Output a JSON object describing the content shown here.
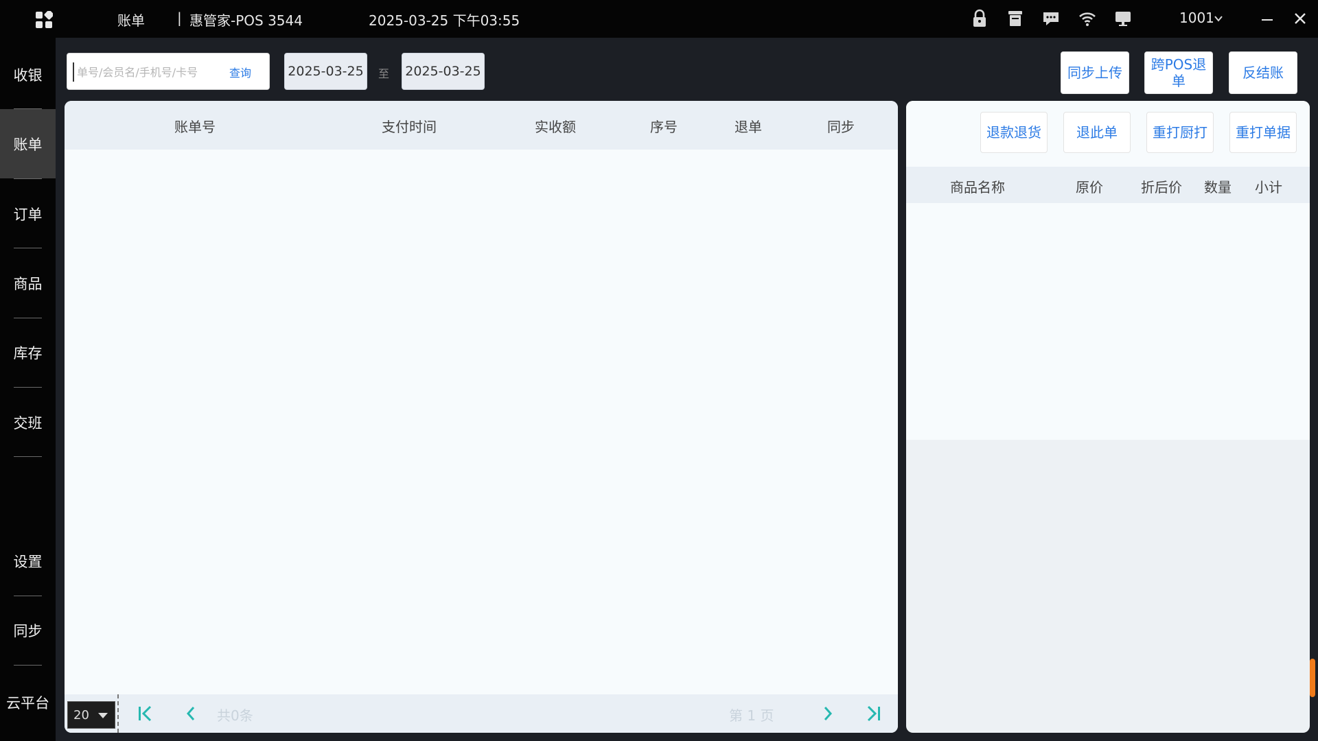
{
  "titlebar": {
    "page": "账单",
    "separator": "|",
    "app_name": "惠管家-POS 3544",
    "datetime": "2025-03-25 下午03:55",
    "user": "1001"
  },
  "sidebar": {
    "items": [
      {
        "label": "收银"
      },
      {
        "label": "账单",
        "active": true
      },
      {
        "label": "订单"
      },
      {
        "label": "商品"
      },
      {
        "label": "库存"
      },
      {
        "label": "交班"
      },
      {
        "label": "设置"
      },
      {
        "label": "同步"
      },
      {
        "label": "云平台"
      }
    ]
  },
  "search": {
    "placeholder": "单号/会员名/手机号/卡号",
    "value": "",
    "button": "查询"
  },
  "date_range": {
    "start": "2025-03-25",
    "separator": "至",
    "end": "2025-03-25"
  },
  "top_actions": {
    "sync_upload": "同步上传",
    "cross_pos_refund": "跨POS退单",
    "reverse_settle": "反结账"
  },
  "bill_table": {
    "columns": [
      "账单号",
      "支付时间",
      "实收额",
      "序号",
      "退单",
      "同步"
    ],
    "rows": []
  },
  "pagination": {
    "page_size": "20",
    "total": "共0条",
    "current_page": "第 1 页"
  },
  "detail_actions": {
    "refund_return": "退款退货",
    "refund_this": "退此单",
    "reprint_kitchen": "重打厨打",
    "reprint_receipt": "重打单据"
  },
  "detail_table": {
    "columns": [
      "商品名称",
      "原价",
      "折后价",
      "数量",
      "小计"
    ],
    "rows": []
  },
  "colors": {
    "accent": "#2c7be5",
    "sidebar_bg": "#050505",
    "active_nav": "#3a3a3a",
    "pager_teal": "#26b8b0",
    "scroll_thumb": "#f07b1a"
  }
}
